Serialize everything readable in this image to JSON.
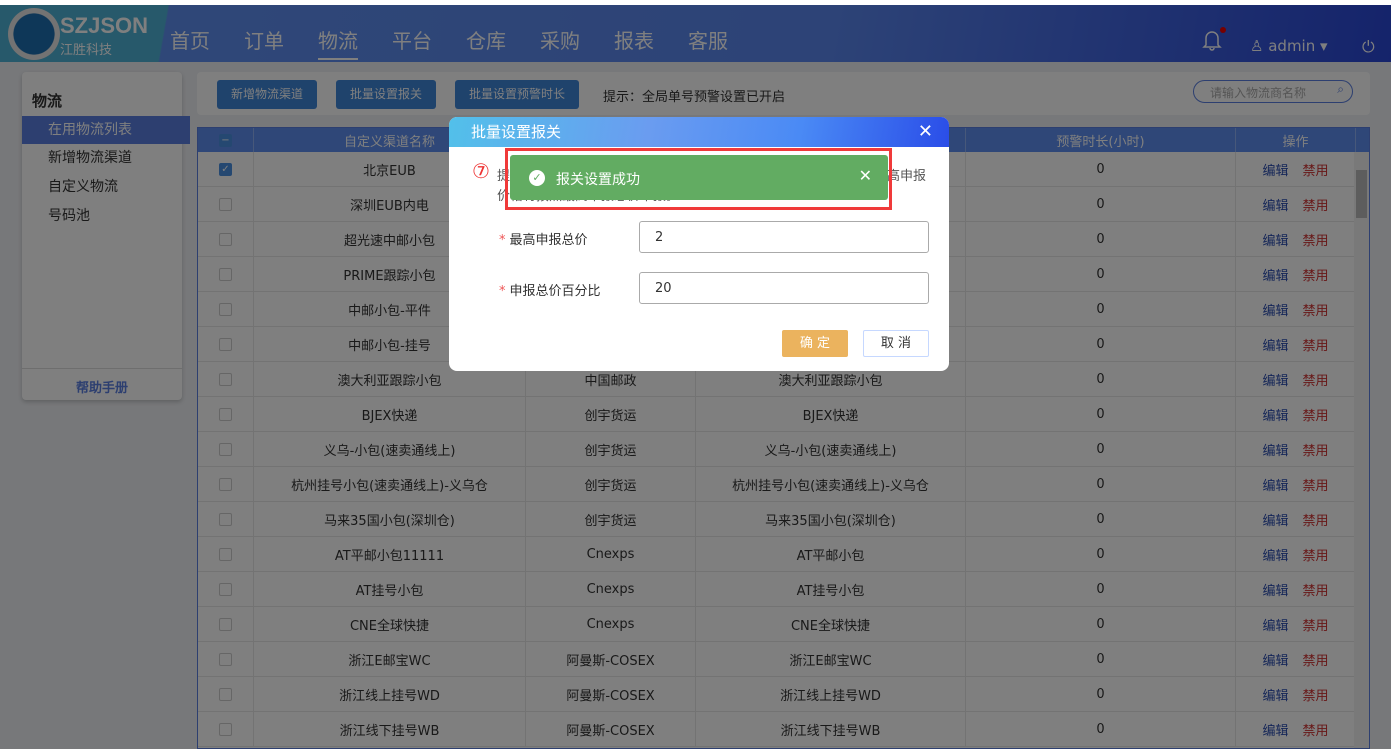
{
  "header": {
    "brand": "SZJSON",
    "brand_sub": "江胜科技",
    "nav": [
      "首页",
      "订单",
      "物流",
      "平台",
      "仓库",
      "采购",
      "报表",
      "客服"
    ],
    "active_nav": "物流",
    "user": "admin"
  },
  "sidebar": {
    "title": "物流",
    "items": [
      "在用物流列表",
      "新增物流渠道",
      "自定义物流",
      "号码池"
    ],
    "active": "在用物流列表",
    "help": "帮助手册"
  },
  "toolbar": {
    "buttons": [
      "新增物流渠道",
      "批量设置报关",
      "批量设置预警时长"
    ],
    "tip": "提示：全局单号预警设置已开启",
    "search_placeholder": "请输入物流商名称"
  },
  "table": {
    "headers": [
      "",
      "自定义渠道名称",
      "",
      "",
      "预警时长(小时)",
      "操作"
    ],
    "edit_label": "编辑",
    "disable_label": "禁用",
    "rows": [
      {
        "checked": true,
        "name": "北京EUB",
        "carrier": "",
        "channel": "",
        "warn": "0"
      },
      {
        "checked": false,
        "name": "深圳EUB内电",
        "carrier": "",
        "channel": "",
        "warn": "0"
      },
      {
        "checked": false,
        "name": "超光速中邮小包",
        "carrier": "",
        "channel": "",
        "warn": "0"
      },
      {
        "checked": false,
        "name": "PRIME跟踪小包",
        "carrier": "",
        "channel": "",
        "warn": "0"
      },
      {
        "checked": false,
        "name": "中邮小包-平件",
        "carrier": "",
        "channel": "",
        "warn": "0"
      },
      {
        "checked": false,
        "name": "中邮小包-挂号",
        "carrier": "",
        "channel": "",
        "warn": "0"
      },
      {
        "checked": false,
        "name": "澳大利亚跟踪小包",
        "carrier": "中国邮政",
        "channel": "澳大利亚跟踪小包",
        "warn": "0"
      },
      {
        "checked": false,
        "name": "BJEX快递",
        "carrier": "创宇货运",
        "channel": "BJEX快递",
        "warn": "0"
      },
      {
        "checked": false,
        "name": "义乌-小包(速卖通线上)",
        "carrier": "创宇货运",
        "channel": "义乌-小包(速卖通线上)",
        "warn": "0"
      },
      {
        "checked": false,
        "name": "杭州挂号小包(速卖通线上)-义乌仓",
        "carrier": "创宇货运",
        "channel": "杭州挂号小包(速卖通线上)-义乌仓",
        "warn": "0"
      },
      {
        "checked": false,
        "name": "马来35国小包(深圳仓)",
        "carrier": "创宇货运",
        "channel": "马来35国小包(深圳仓)",
        "warn": "0"
      },
      {
        "checked": false,
        "name": "AT平邮小包11111",
        "carrier": "Cnexps",
        "channel": "AT平邮小包",
        "warn": "0"
      },
      {
        "checked": false,
        "name": "AT挂号小包",
        "carrier": "Cnexps",
        "channel": "AT挂号小包",
        "warn": "0"
      },
      {
        "checked": false,
        "name": "CNE全球快捷",
        "carrier": "Cnexps",
        "channel": "CNE全球快捷",
        "warn": "0"
      },
      {
        "checked": false,
        "name": "浙江E邮宝WC",
        "carrier": "阿曼斯-COSEX",
        "channel": "浙江E邮宝WC",
        "warn": "0"
      },
      {
        "checked": false,
        "name": "浙江线上挂号WD",
        "carrier": "阿曼斯-COSEX",
        "channel": "浙江线上挂号WD",
        "warn": "0"
      },
      {
        "checked": false,
        "name": "浙江线下挂号WB",
        "carrier": "阿曼斯-COSEX",
        "channel": "浙江线下挂号WB",
        "warn": "0"
      }
    ]
  },
  "modal": {
    "title": "批量设置报关",
    "step": "⑦",
    "tip": "提示：优先按照申报比例计算，然后对比最高申报价格，如果超出最高申报价格将按照最高申报总价申报。",
    "fields": [
      {
        "label": "最高申报总价",
        "value": "2"
      },
      {
        "label": "申报总价百分比",
        "value": "20"
      }
    ],
    "ok": "确 定",
    "cancel": "取 消"
  },
  "toast": {
    "message": "报关设置成功",
    "color": "#62ac62"
  }
}
